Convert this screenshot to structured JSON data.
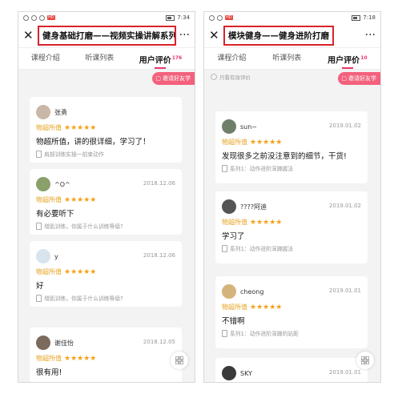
{
  "left": {
    "status": {
      "time": "7:34"
    },
    "title": "健身基础打磨——视频实操讲解系列",
    "close": "✕",
    "more": "···",
    "tabs": [
      {
        "label": "课程介绍"
      },
      {
        "label": "听课列表"
      },
      {
        "label": "用户评价",
        "count": "176"
      }
    ],
    "invite": "邀请好友学",
    "reviews": [
      {
        "name": "张勇",
        "date": "",
        "rating_label": "物超所值",
        "stars": 5,
        "text": "物超所值，讲的很详细，学习了！",
        "course": "肩部训练实操一前束动作"
      },
      {
        "name": "^O^",
        "date": "2018.12.06",
        "rating_label": "物超所值",
        "stars": 5,
        "text": "有必要听下",
        "course": "增肌训练，你属于什么训练等级?"
      },
      {
        "name": "y",
        "date": "2018.12.06",
        "rating_label": "物超所值",
        "stars": 5,
        "text": "好",
        "course": "增肌训练，你属于什么训练等级?"
      },
      {
        "name": "谢佳怡",
        "date": "2018.12.05",
        "rating_label": "物超所值",
        "stars": 5,
        "text": "很有用!",
        "course": ""
      }
    ]
  },
  "right": {
    "status": {
      "time": "7:18"
    },
    "title": "模块健身——健身进阶打磨",
    "close": "✕",
    "more": "···",
    "tabs": [
      {
        "label": "课程介绍"
      },
      {
        "label": "听课列表"
      },
      {
        "label": "用户评价",
        "count": "10"
      }
    ],
    "filter": "只看有效评价",
    "invite": "邀请好友学",
    "reviews": [
      {
        "name": "sun~",
        "date": "2019.01.02",
        "rating_label": "物超所值",
        "stars": 5,
        "text": "发现很多之前没注意到的细节，干货!",
        "course": "系列1：动作进阶深蹲握法"
      },
      {
        "name": "????阿迪",
        "date": "2019.01.02",
        "rating_label": "物超所值",
        "stars": 5,
        "text": "学习了",
        "course": "系列1：动作进阶深蹲握法"
      },
      {
        "name": "cheong",
        "date": "2019.01.01",
        "rating_label": "物超所值",
        "stars": 5,
        "text": "不错啊",
        "course": "系列1：动作进阶深蹲的站距"
      },
      {
        "name": "SKY",
        "date": "2019.01.01",
        "rating_label": "物超所值",
        "stars": 5,
        "text": "",
        "course": ""
      }
    ]
  },
  "colors": {
    "accent": "#e9386a",
    "star": "#f2a21a",
    "highlight_box": "#d9232b",
    "invite_bg": "#f3617d"
  },
  "icons": {
    "close": "close-icon",
    "more": "more-icon",
    "grid": "grid-icon",
    "doc": "document-icon"
  }
}
